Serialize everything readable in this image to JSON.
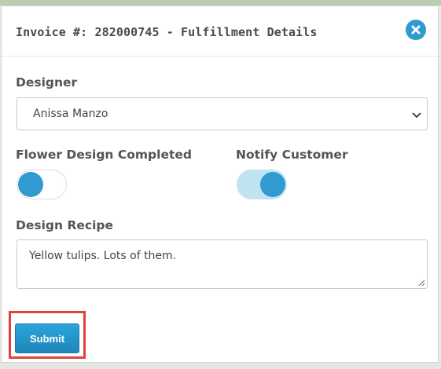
{
  "modal": {
    "title": "Invoice #: 282000745 - Fulfillment Details",
    "close_icon": "close-circle-icon"
  },
  "designer": {
    "label": "Designer",
    "selected": "Anissa Manzo"
  },
  "flower_design_completed": {
    "label": "Flower Design Completed",
    "checked": false
  },
  "notify_customer": {
    "label": "Notify Customer",
    "checked": true
  },
  "design_recipe": {
    "label": "Design Recipe",
    "value": "Yellow tulips. Lots of them."
  },
  "actions": {
    "submit_label": "Submit"
  },
  "colors": {
    "accent": "#2f9bd0",
    "highlight": "#e0413a",
    "toggle_on_track": "#bfe3f1"
  }
}
